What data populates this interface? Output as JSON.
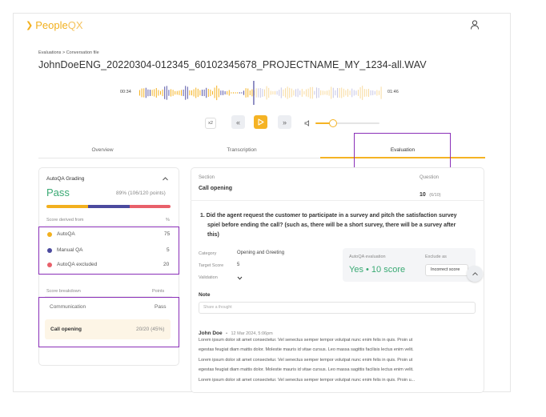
{
  "app": {
    "brand_people": "People",
    "brand_qx": "QX"
  },
  "breadcrumb": "Evaluations > Conversation file",
  "file_title": "JohnDoeENG_20220304-012345_60102345678_PROJECTNAME_MY_1234-all.WAV",
  "player": {
    "time_start": "00:34",
    "time_end": "01:46",
    "speed": "x2",
    "played_fraction": 0.47,
    "volume_fraction": 0.28
  },
  "tabs": [
    {
      "label": "Overview"
    },
    {
      "label": "Transcription"
    },
    {
      "label": "Evaluation"
    }
  ],
  "grading": {
    "title": "AutoQA Grading",
    "result": "Pass",
    "score": "89% (106/120 points)",
    "derived_header": "Score derived from",
    "percent_header": "%",
    "sources": [
      {
        "label": "AutoQA",
        "value": "75",
        "color": "#f2b01e"
      },
      {
        "label": "Manual QA",
        "value": "5",
        "color": "#4b4a9e"
      },
      {
        "label": "AutoQA excluded",
        "value": "20",
        "color": "#e8606a"
      }
    ],
    "breakdown_header": "Score breakdown",
    "points_header": "Points",
    "category": "Communication",
    "category_result": "Pass",
    "item": "Call opening",
    "item_score": "20/20 (45%)"
  },
  "section": {
    "section_label": "Section",
    "section_value": "Call opening",
    "question_label": "Question",
    "question_number": "10",
    "question_total": "(6/10)"
  },
  "question": {
    "lines": [
      "1. Did the agent request the customer to participate in a survey and pitch the satisfaction survey",
      "spiel before ending the call? (such as, there will be a short survey, there will be a survey after",
      "this)"
    ]
  },
  "meta": {
    "category_label": "Category",
    "category_value": "Opening and Greeting",
    "target_label": "Target Score",
    "target_value": "5",
    "validation_label": "Validation"
  },
  "evaluation": {
    "label": "AutoQA evaluation",
    "value": "Yes • 10 score",
    "exclude_label": "Exclude as",
    "exclude_value": "Incorrect score"
  },
  "note": {
    "label": "Note",
    "placeholder": "Share a thought"
  },
  "comment": {
    "author": "John Doe",
    "sep": "•",
    "date": "12 Mar 2024, 5:06pm",
    "lines": [
      "Lorem ipsum dolor sit amet consectetur. Vel senectus semper tempor volutpat nunc enim felis in quis. Proin ut",
      "egestas feugiat diam mattis dolor. Molestie mauris id vitae cursus. Leo massa sagittis facilisis lectus enim velit.",
      "Lorem ipsum dolor sit amet consectetur. Vel senectus semper tempor volutpat nunc enim felis in quis. Proin ut",
      "egestas feugiat diam mattis dolor. Molestie mauris id vitae cursus. Leo massa sagittis facilisis lectus enim velit.",
      "Lorem ipsum dolor sit amet consectetur. Vel senectus semper tempor volutpat nunc enim felis in quis. Proin u..."
    ]
  },
  "colors": {
    "accent": "#f5b324",
    "pass": "#3aaa74",
    "highlight": "#8a2fb8"
  }
}
